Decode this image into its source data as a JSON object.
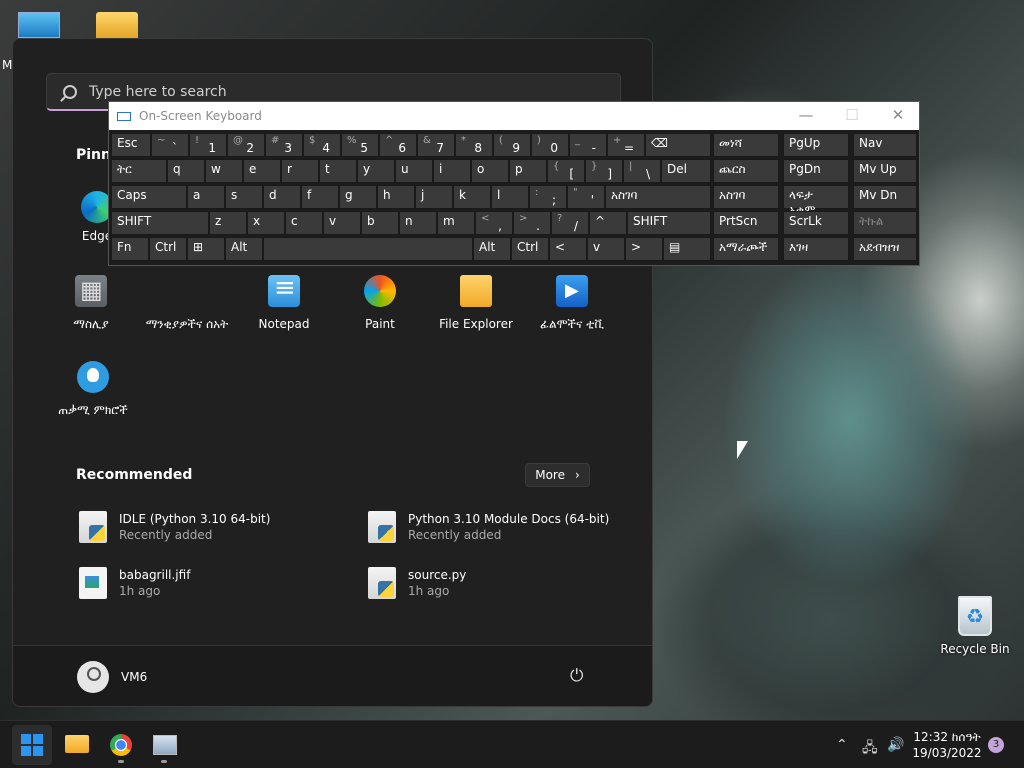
{
  "desktop": {
    "edge_label_fragment": "M",
    "recycle_bin": "Recycle Bin"
  },
  "start_menu": {
    "search_placeholder": "Type here to search",
    "pinned_title": "Pinne",
    "edge": "Edge",
    "apps": [
      {
        "label": "ማስሊያ",
        "icon": "calculator-icon"
      },
      {
        "label": "ማንቂያዎችና ሰአት",
        "icon": "alarm-clock-icon"
      },
      {
        "label": "Notepad",
        "icon": "notepad-icon"
      },
      {
        "label": "Paint",
        "icon": "paint-icon"
      },
      {
        "label": "File Explorer",
        "icon": "folder-icon"
      },
      {
        "label": "ፊልሞችና ቲቪ",
        "icon": "films-tv-icon"
      },
      {
        "label": "ጠቃሚ ምክሮች",
        "icon": "tips-icon"
      }
    ],
    "recommended_title": "Recommended",
    "more_label": "More",
    "recommended": [
      {
        "name": "IDLE (Python 3.10 64-bit)",
        "sub": "Recently added"
      },
      {
        "name": "Python 3.10 Module Docs (64-bit)",
        "sub": "Recently added"
      },
      {
        "name": "babagrill.jfif",
        "sub": "1h ago"
      },
      {
        "name": "source.py",
        "sub": "1h ago"
      }
    ],
    "user": "VM6"
  },
  "osk": {
    "title": "On-Screen Keyboard",
    "row1": [
      {
        "m": "Esc"
      },
      {
        "s": "~",
        "m": "`"
      },
      {
        "s": "!",
        "m": "1"
      },
      {
        "s": "@",
        "m": "2"
      },
      {
        "s": "#",
        "m": "3"
      },
      {
        "s": "$",
        "m": "4"
      },
      {
        "s": "%",
        "m": "5"
      },
      {
        "s": "^",
        "m": "6"
      },
      {
        "s": "&",
        "m": "7"
      },
      {
        "s": "*",
        "m": "8"
      },
      {
        "s": "(",
        "m": "9"
      },
      {
        "s": ")",
        "m": "0"
      },
      {
        "s": "_",
        "m": "-"
      },
      {
        "s": "+",
        "m": "="
      },
      {
        "m": "⌫"
      }
    ],
    "row2": [
      {
        "m": "ትር"
      },
      {
        "m": "q"
      },
      {
        "m": "w"
      },
      {
        "m": "e"
      },
      {
        "m": "r"
      },
      {
        "m": "t"
      },
      {
        "m": "y"
      },
      {
        "m": "u"
      },
      {
        "m": "i"
      },
      {
        "m": "o"
      },
      {
        "m": "p"
      },
      {
        "s": "{",
        "m": "["
      },
      {
        "s": "}",
        "m": "]"
      },
      {
        "s": "|",
        "m": "\\"
      },
      {
        "m": "Del"
      }
    ],
    "row3": [
      {
        "m": "Caps"
      },
      {
        "m": "a"
      },
      {
        "m": "s"
      },
      {
        "m": "d"
      },
      {
        "m": "f"
      },
      {
        "m": "g"
      },
      {
        "m": "h"
      },
      {
        "m": "j"
      },
      {
        "m": "k"
      },
      {
        "m": "l"
      },
      {
        "s": ":",
        "m": ";"
      },
      {
        "s": "\"",
        "m": "'"
      },
      {
        "m": "አስገባ"
      }
    ],
    "row4": [
      {
        "m": "SHIFT"
      },
      {
        "m": "z"
      },
      {
        "m": "x"
      },
      {
        "m": "c"
      },
      {
        "m": "v"
      },
      {
        "m": "b"
      },
      {
        "m": "n"
      },
      {
        "m": "m"
      },
      {
        "s": "<",
        "m": ","
      },
      {
        "s": ">",
        "m": "."
      },
      {
        "s": "?",
        "m": "/"
      },
      {
        "m": "^"
      },
      {
        "m": "SHIFT"
      }
    ],
    "row5": [
      {
        "m": "Fn"
      },
      {
        "m": "Ctrl"
      },
      {
        "m": "⊞"
      },
      {
        "m": "Alt"
      },
      {
        "m": ""
      },
      {
        "m": "Alt"
      },
      {
        "m": "Ctrl"
      },
      {
        "m": "<"
      },
      {
        "m": "v"
      },
      {
        "m": ">"
      },
      {
        "m": "▤"
      }
    ],
    "side": [
      [
        "መነሻ",
        "PgUp",
        "Nav"
      ],
      [
        "ጨርስ",
        "PgDn",
        "Mv Up"
      ],
      [
        "አስገባ",
        "ላፍታ አቁም",
        "Mv Dn"
      ],
      [
        "PrtScn",
        "ScrLk",
        "ትኩል"
      ],
      [
        "አማራጮች",
        "እገዛ",
        "አደብዝዝ"
      ]
    ]
  },
  "taskbar": {
    "time": "12:32 ከሰዓት",
    "date": "19/03/2022",
    "notifications": "3"
  }
}
